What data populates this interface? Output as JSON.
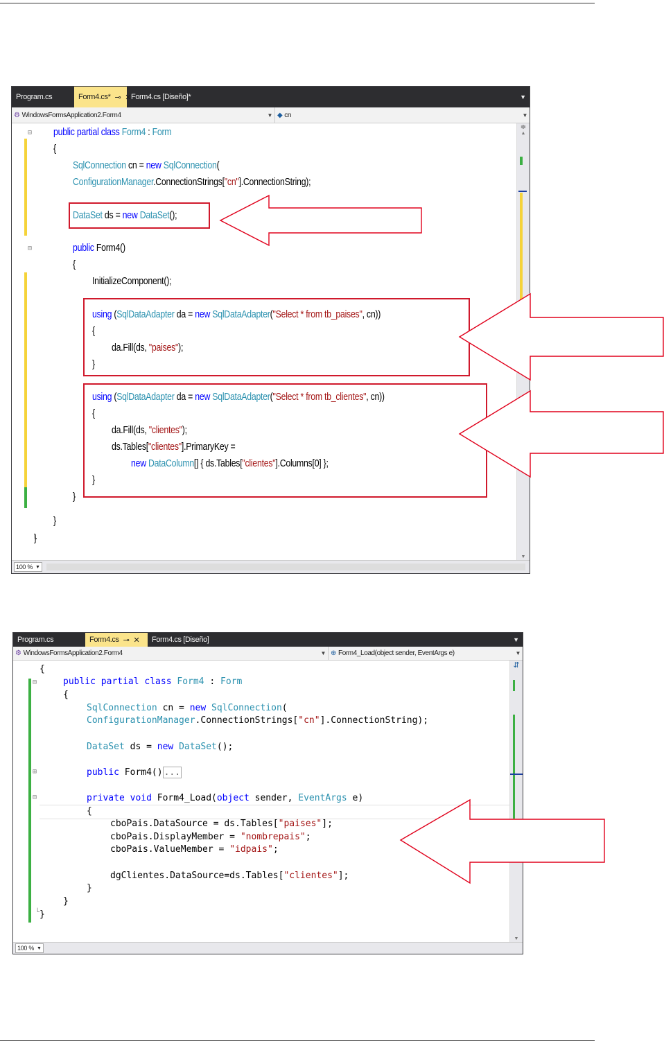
{
  "screenshot1": {
    "tabs": [
      {
        "label": "Program.cs",
        "active": false
      },
      {
        "label": "Form4.cs*",
        "active": true
      },
      {
        "label": "Form4.cs [Diseño]*",
        "active": false
      }
    ],
    "nav_left": "WindowsFormsApplication2.Form4",
    "nav_right": "cn",
    "zoom": "100 %",
    "code": {
      "l1": {
        "kw1": "public partial class ",
        "ty1": "Form4",
        " t1": " : ",
        "ty2": "Form"
      },
      "l3": {
        "ty1": "SqlConnection",
        " t1": " cn = ",
        "kw1": "new ",
        "ty2": "SqlConnection",
        "t2": "("
      },
      "l4": {
        "ty1": "ConfigurationManager",
        "t1": ".ConnectionStrings[",
        "st1": "\"cn\"",
        "t2": "].ConnectionString);"
      },
      "l6": {
        "ty1": "DataSet",
        "t1": " ds = ",
        "kw1": "new ",
        "ty2": "DataSet",
        "t2": "();"
      },
      "l8": {
        "kw1": "public ",
        "t1": "Form4()"
      },
      "l10": {
        "t1": "InitializeComponent();"
      },
      "l12": {
        "kw1": "using ",
        "t1": "(",
        "ty1": "SqlDataAdapter",
        "t2": " da = ",
        "kw2": "new ",
        "ty2": "SqlDataAdapter",
        "t3": "(",
        "st1": "\"Select * from tb_paises\"",
        "t4": ", cn))"
      },
      "l14": {
        "t1": "da.Fill(ds, ",
        "st1": "\"paises\"",
        "t2": ");"
      },
      "l17": {
        "kw1": "using ",
        "t1": "(",
        "ty1": "SqlDataAdapter",
        "t2": " da = ",
        "kw2": "new ",
        "ty2": "SqlDataAdapter",
        "t3": "(",
        "st1": "\"Select * from tb_clientes\"",
        "t4": ", cn))"
      },
      "l19": {
        "t1": "da.Fill(ds, ",
        "st1": "\"clientes\"",
        "t2": ");"
      },
      "l20": {
        "t1": "ds.Tables[",
        "st1": "\"clientes\"",
        "t2": "].PrimaryKey ="
      },
      "l21": {
        "kw1": "new ",
        "ty1": "DataColumn",
        "t1": "[] { ds.Tables[",
        "st1": "\"clientes\"",
        "t2": "].Columns[0] };"
      },
      "open": "{",
      "close": "}"
    }
  },
  "screenshot2": {
    "tabs": [
      {
        "label": "Program.cs",
        "active": false
      },
      {
        "label": "Form4.cs",
        "active": true
      },
      {
        "label": "Form4.cs [Diseño]",
        "active": false
      }
    ],
    "nav_left": "WindowsFormsApplication2.Form4",
    "nav_right": "Form4_Load(object sender, EventArgs e)",
    "zoom": "100 %",
    "code": {
      "l1": {
        "kw1": "public partial class ",
        "ty1": "Form4",
        "t1": " : ",
        "ty2": "Form"
      },
      "l3": {
        "ty1": "SqlConnection",
        "t1": " cn = ",
        "kw1": "new ",
        "ty2": "SqlConnection",
        "t2": "("
      },
      "l4": {
        "ty1": "ConfigurationManager",
        "t1": ".ConnectionStrings[",
        "st1": "\"cn\"",
        "t2": "].ConnectionString);"
      },
      "l6": {
        "ty1": "DataSet",
        "t1": " ds = ",
        "kw1": "new ",
        "ty2": "DataSet",
        "t2": "();"
      },
      "l8": {
        "kw1": "public ",
        "t1": "Form4()",
        "t2": "..."
      },
      "l10": {
        "kw1": "private void ",
        "t1": "Form4_Load(",
        "kw2": "object ",
        "t2": "sender, ",
        "ty1": "EventArgs",
        "t3": " e)"
      },
      "l12": {
        "t1": "cboPais.DataSource = ds.Tables[",
        "st1": "\"paises\"",
        "t2": "];"
      },
      "l13": {
        "t1": "cboPais.DisplayMember = ",
        "st1": "\"nombrepais\"",
        "t2": ";"
      },
      "l14": {
        "t1": "cboPais.ValueMember = ",
        "st1": "\"idpais\"",
        "t2": ";"
      },
      "l16": {
        "t1": "dgClientes.DataSource=ds.Tables[",
        "st1": "\"clientes\"",
        "t2": "];"
      },
      "open": "{",
      "close": "}"
    }
  },
  "colors": {
    "keyword": "#0000ff",
    "type": "#2b91af",
    "string": "#a31515",
    "annotation": "#d0192c",
    "arrow": "#e0001b"
  }
}
